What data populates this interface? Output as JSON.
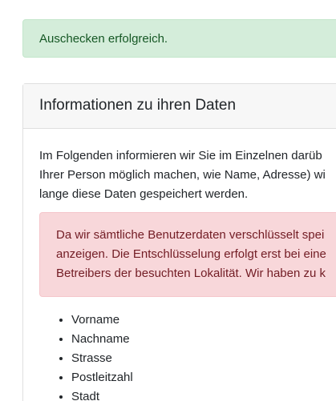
{
  "success_alert": {
    "text": "Auschecken erfolgreich."
  },
  "info_card": {
    "title": "Informationen zu ihren Daten",
    "intro_lines": [
      "Im Folgenden informieren wir Sie im Einzelnen darüb",
      "Ihrer Person möglich machen, wie Name, Adresse) wi",
      "lange diese Daten gespeichert werden."
    ],
    "warning_lines": [
      "Da wir sämtliche Benutzerdaten verschlüsselt spei",
      "anzeigen. Die Entschlüsselung erfolgt erst bei eine",
      "Betreibers der besuchten Lokalität. Wir haben zu k"
    ],
    "fields": [
      "Vorname",
      "Nachname",
      "Strasse",
      "Postleitzahl",
      "Stadt"
    ]
  },
  "colors": {
    "success_bg": "#d4edda",
    "success_text": "#155724",
    "danger_bg": "#f8d7da",
    "danger_text": "#721c24",
    "card_header_bg": "#f7f7f7"
  }
}
